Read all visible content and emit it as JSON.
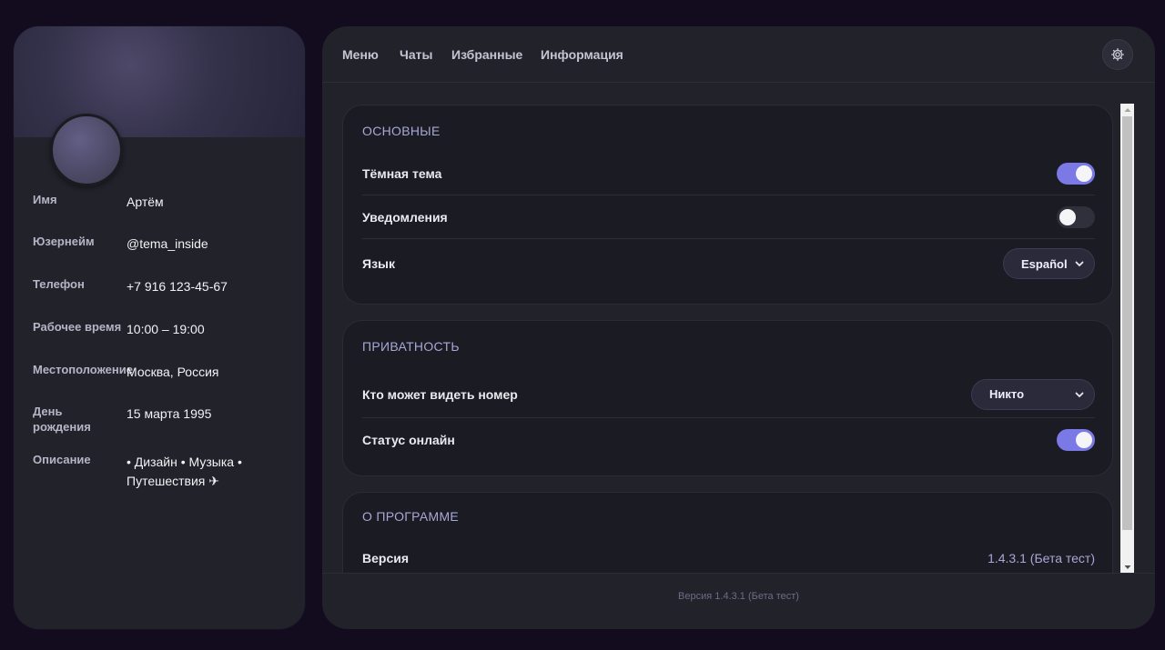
{
  "profile": {
    "fields": [
      {
        "label": "Имя",
        "value": "Артём"
      },
      {
        "label": "Юзернейм",
        "value": "@tema_inside"
      },
      {
        "label": "Телефон",
        "value": "+7 916 123-45-67"
      },
      {
        "label": "Рабочее время",
        "value": "10:00 – 19:00"
      },
      {
        "label": "Местоположение",
        "value": "Москва, Россия"
      },
      {
        "label": "День рождения",
        "value": "15 марта 1995"
      },
      {
        "label": "Описание",
        "value": "• Дизайн • Музыка • Путешествия ✈"
      }
    ]
  },
  "nav": {
    "items": [
      "Меню",
      "Чаты",
      "Избранные",
      "Информация"
    ],
    "settings_icon": "gear-icon"
  },
  "sections": {
    "main": {
      "title": "ОСНОВНЫЕ",
      "dark_theme_label": "Тёмная тема",
      "dark_theme_on": true,
      "notifications_label": "Уведомления",
      "notifications_on": false,
      "language_label": "Язык",
      "language_value": "Español"
    },
    "privacy": {
      "title": "ПРИВАТНОСТЬ",
      "phone_visibility_label": "Кто может видеть номер",
      "phone_visibility_value": "Никто",
      "online_status_label": "Статус онлайн",
      "online_status_on": true
    },
    "about": {
      "title": "О ПРОГРАММЕ",
      "version_label": "Версия",
      "version_value": "1.4.3.1 (Бета тест)"
    }
  },
  "footer": {
    "text": "Версия 1.4.3.1 (Бета тест)"
  },
  "colors": {
    "accent": "#7b79e6",
    "background": "#130c1f",
    "panel": "#22222b"
  }
}
